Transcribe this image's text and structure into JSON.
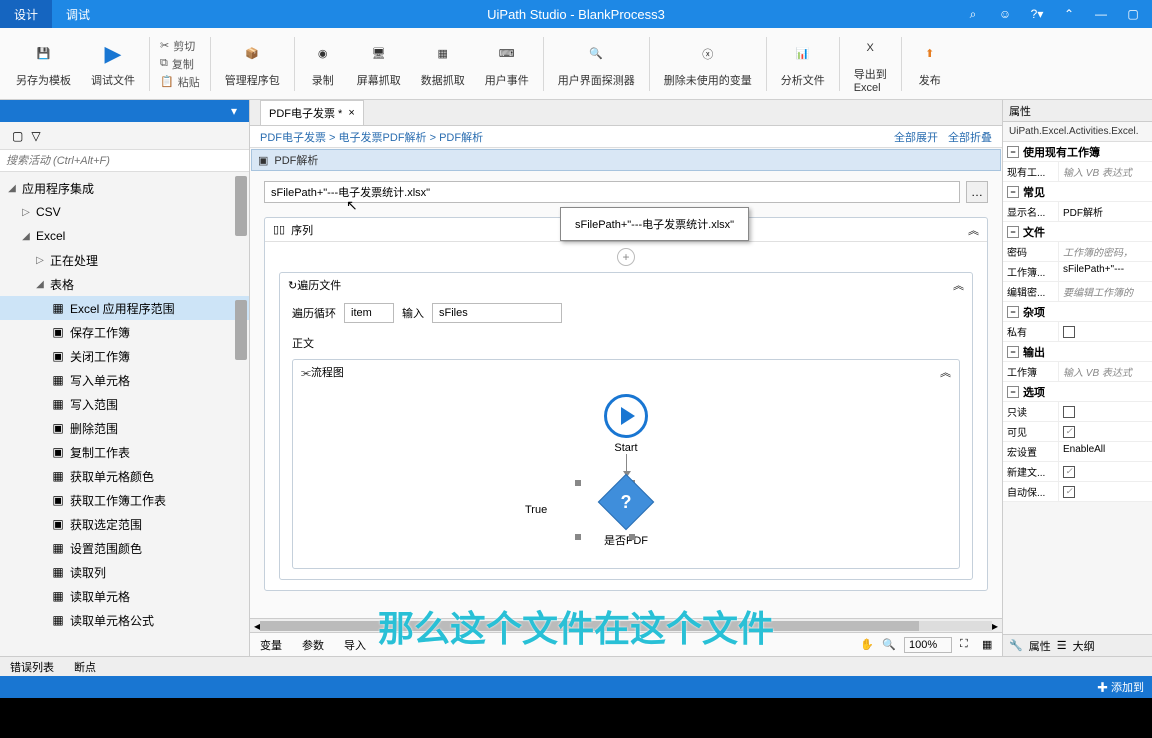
{
  "title": "UiPath Studio - BlankProcess3",
  "menu": {
    "design": "设计",
    "debug": "调试"
  },
  "ribbon": {
    "saveAs": "另存为模板",
    "debugFile": "调试文件",
    "cut": "剪切",
    "copy": "复制",
    "paste": "粘贴",
    "packages": "管理程序包",
    "record": "录制",
    "screen": "屏幕抓取",
    "dataExtract": "数据抓取",
    "userEvents": "用户事件",
    "uiExplorer": "用户界面探测器",
    "removeVars": "删除未使用的变量",
    "analyze": "分析文件",
    "exportExcel1": "导出到",
    "exportExcel2": "Excel",
    "publish": "发布"
  },
  "search_placeholder": "搜索活动 (Ctrl+Alt+F)",
  "tree": {
    "root": "应用程序集成",
    "csv": "CSV",
    "excel": "Excel",
    "processing": "正在处理",
    "table": "表格",
    "items": [
      "Excel 应用程序范围",
      "保存工作簿",
      "关闭工作簿",
      "写入单元格",
      "写入范围",
      "删除范围",
      "复制工作表",
      "获取单元格颜色",
      "获取工作簿工作表",
      "获取选定范围",
      "设置范围颜色",
      "读取列",
      "读取单元格",
      "读取单元格公式"
    ]
  },
  "docTab": "PDF电子发票 *",
  "breadcrumb": {
    "a": "PDF电子发票",
    "b": "电子发票PDF解析",
    "c": "PDF解析",
    "expand": "全部展开",
    "collapse": "全部折叠"
  },
  "activityTitle": "PDF解析",
  "filepath": "sFilePath+\"---电子发票统计.xlsx\"",
  "tooltip": "sFilePath+\"---电子发票统计.xlsx\"",
  "seq": "序列",
  "foreach": {
    "title": "遍历文件",
    "loopLabel": "遍历循环",
    "loopVal": "item",
    "inLabel": "输入",
    "inVal": "sFiles",
    "body": "正文"
  },
  "flowchart": "流程图",
  "start": "Start",
  "trueLabel": "True",
  "decision": "是否PDF",
  "statusLeft": {
    "vars": "变量",
    "args": "参数",
    "imports": "导入"
  },
  "zoom": "100%",
  "bottomTabs": {
    "errors": "错误列表",
    "breakpoints": "断点"
  },
  "props": {
    "header": "属性",
    "className": "UiPath.Excel.Activities.Excel.",
    "catUse": "使用现有工作簿",
    "existWb": "现有工...",
    "vbExpr": "输入 VB 表达式",
    "catCommon": "常见",
    "dispName": "显示名...",
    "dispVal": "PDF解析",
    "catFile": "文件",
    "pwd": "密码",
    "pwdHint": "工作簿的密码，",
    "wb": "工作簿...",
    "wbVal": "sFilePath+\"---",
    "editPwd": "编辑密...",
    "editPwdHint": "要编辑工作簿的",
    "catMisc": "杂项",
    "private": "私有",
    "catOutput": "输出",
    "wbOut": "工作簿",
    "catOptions": "选项",
    "readonly": "只读",
    "visible": "可见",
    "macro": "宏设置",
    "macroVal": "EnableAll",
    "createNew": "新建文...",
    "autosave": "自动保..."
  },
  "propTabs": {
    "props": "属性",
    "outline": "大纲"
  },
  "addLabel": "添加到",
  "caption": "那么这个文件在这个文件"
}
